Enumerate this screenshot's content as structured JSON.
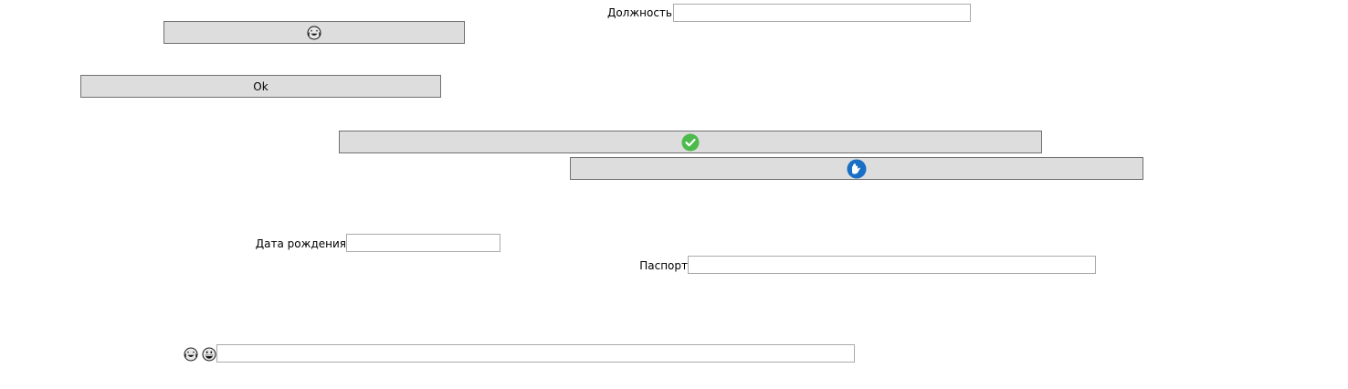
{
  "position_row": {
    "label": "Должность",
    "value": "",
    "placeholder": ""
  },
  "emoji_button": {
    "icon": "grinning-tears-face-icon",
    "label": ""
  },
  "ok_button": {
    "label": "Ok"
  },
  "check_button": {
    "icon": "green-check-circle-icon",
    "color": "#4cbb4c"
  },
  "blue_button": {
    "icon": "blue-hand-circle-icon",
    "color": "#1a6fc4"
  },
  "birthdate_row": {
    "label": "Дата рождения",
    "value": "",
    "placeholder": ""
  },
  "passport_row": {
    "label": "Паспорт",
    "value": "",
    "placeholder": ""
  },
  "emoji_row": {
    "icons": [
      "grinning-tears-face-icon",
      "grinning-face-icon"
    ],
    "value": "",
    "placeholder": ""
  }
}
